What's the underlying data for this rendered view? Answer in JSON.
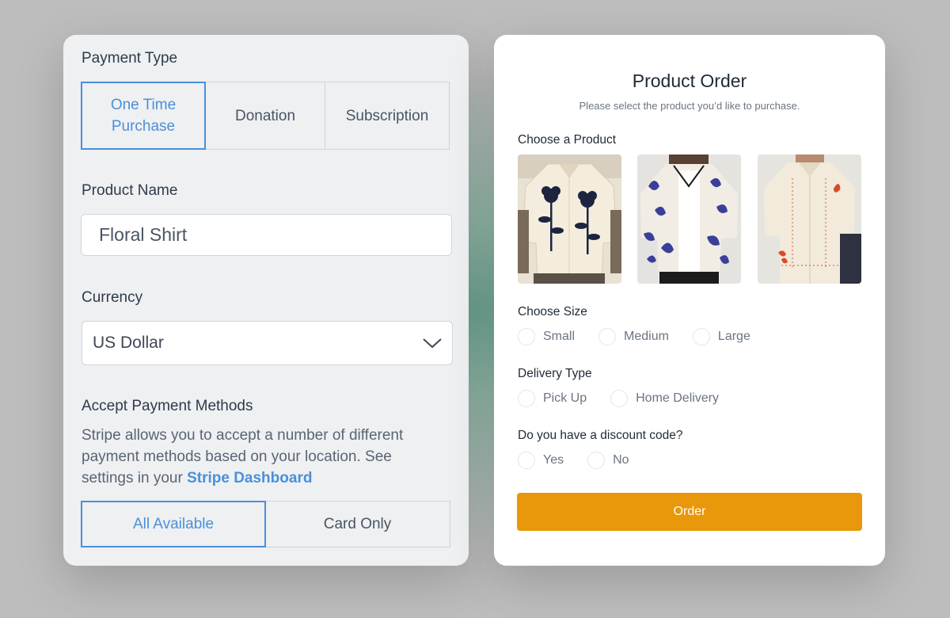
{
  "left": {
    "payment_type": {
      "label": "Payment Type",
      "options": [
        "One Time Purchase",
        "Donation",
        "Subscription"
      ],
      "selected": "One Time Purchase"
    },
    "product_name": {
      "label": "Product Name",
      "value": "Floral Shirt"
    },
    "currency": {
      "label": "Currency",
      "value": "US Dollar"
    },
    "payment_methods": {
      "label": "Accept Payment Methods",
      "description": "Stripe allows you to accept a number of different payment methods based on your location. See settings in your",
      "link": "Stripe Dashboard",
      "options": [
        "All Available",
        "Card Only"
      ],
      "selected": "All Available"
    }
  },
  "right": {
    "title": "Product Order",
    "subtitle": "Please select the product you’d like to purchase.",
    "choose_product_label": "Choose a Product",
    "choose_size": {
      "label": "Choose Size",
      "options": [
        "Small",
        "Medium",
        "Large"
      ]
    },
    "delivery_type": {
      "label": "Delivery Type",
      "options": [
        "Pick Up",
        "Home Delivery"
      ]
    },
    "discount": {
      "label": "Do you have a discount code?",
      "options": [
        "Yes",
        "No"
      ]
    },
    "order_button": "Order"
  },
  "colors": {
    "accent_blue": "#4a90d9",
    "order_orange": "#e8980a",
    "panel_left_bg": "#eef0f2",
    "panel_right_bg": "#ffffff"
  },
  "icons": {
    "currency_dropdown": "chevron-down-icon"
  }
}
